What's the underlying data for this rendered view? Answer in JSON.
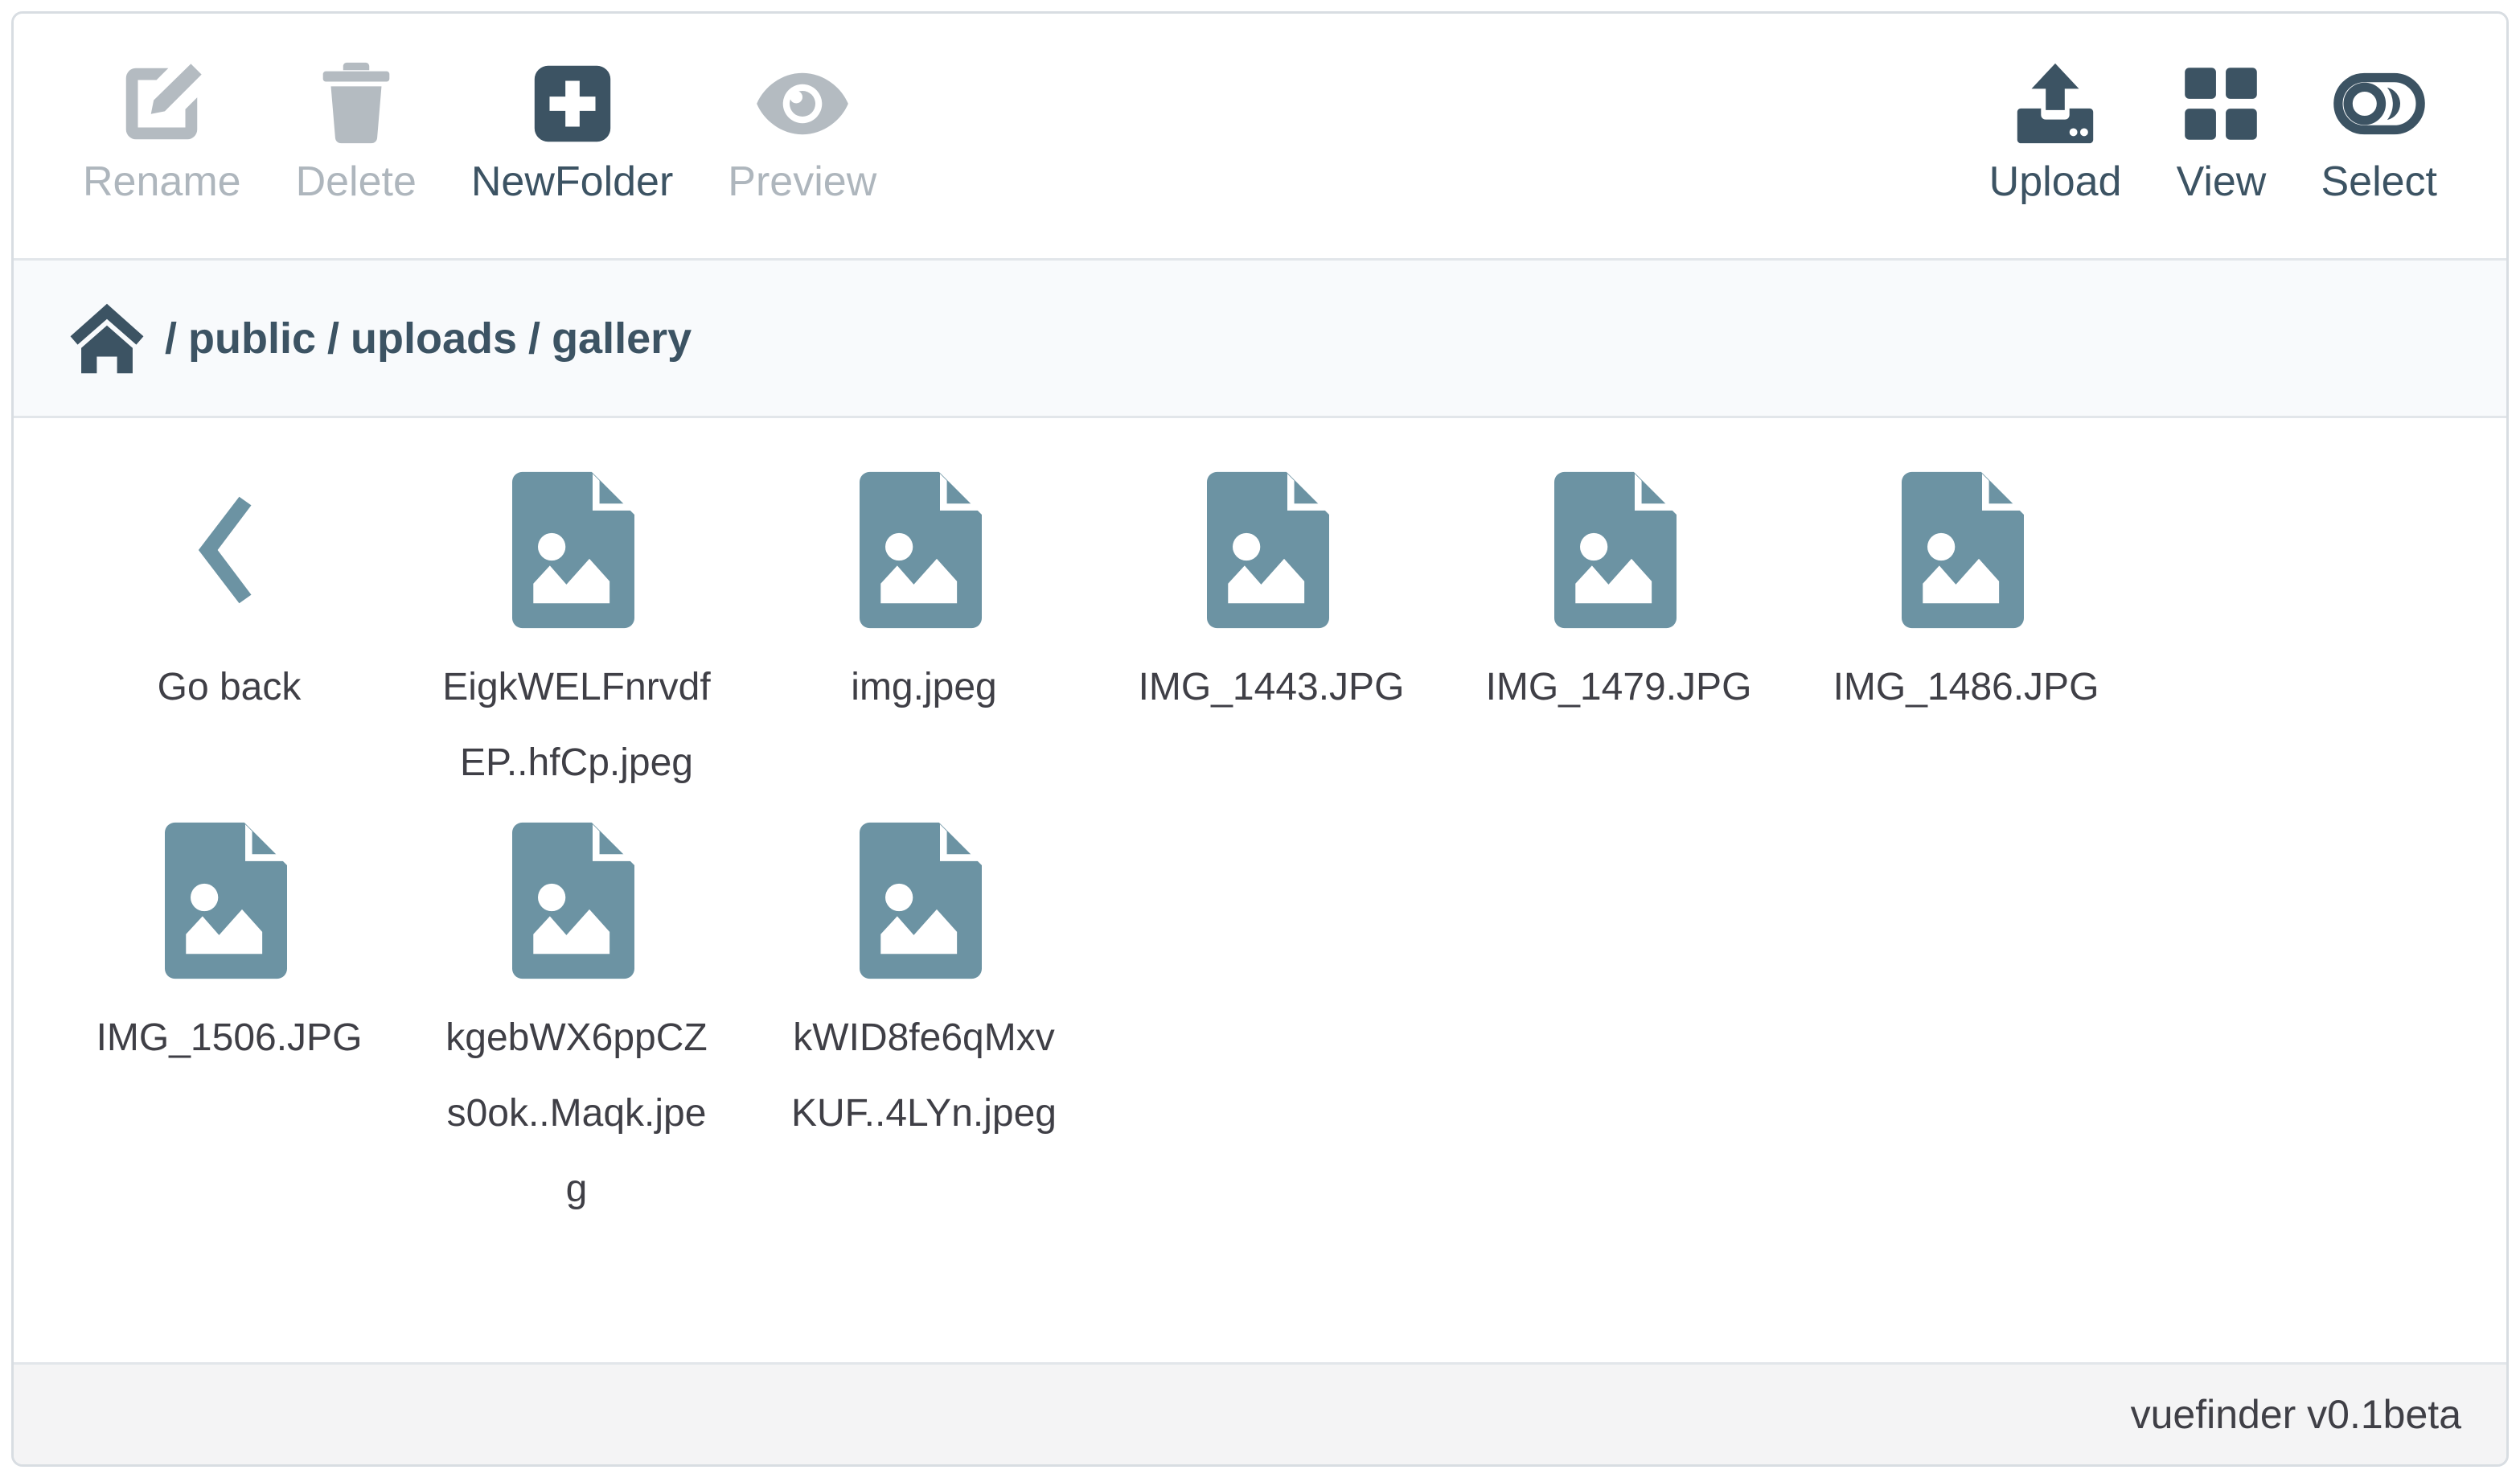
{
  "toolbar": {
    "left_buttons": [
      {
        "label": "Rename",
        "icon": "rename-icon",
        "disabled": true
      },
      {
        "label": "Delete",
        "icon": "trash-icon",
        "disabled": true
      },
      {
        "label": "NewFolder",
        "icon": "plus-square-icon",
        "disabled": false
      },
      {
        "label": "Preview",
        "icon": "eye-icon",
        "disabled": true
      }
    ],
    "right_buttons": [
      {
        "label": "Upload",
        "icon": "upload-icon",
        "disabled": false
      },
      {
        "label": "View",
        "icon": "grid-icon",
        "disabled": false
      },
      {
        "label": "Select",
        "icon": "toggle-on-icon",
        "disabled": false
      }
    ]
  },
  "breadcrumb": {
    "home_icon": "home-icon",
    "separator": "/",
    "segments": [
      "public",
      "uploads",
      "gallery"
    ]
  },
  "files": {
    "go_back": {
      "label": "Go back",
      "icon": "chevron-left-icon"
    },
    "items": [
      {
        "name": "EigkWELFnrvdfEP..hfCp.jpeg",
        "icon": "image-file-icon"
      },
      {
        "name": "img.jpeg",
        "icon": "image-file-icon"
      },
      {
        "name": "IMG_1443.JPG",
        "icon": "image-file-icon"
      },
      {
        "name": "IMG_1479.JPG",
        "icon": "image-file-icon"
      },
      {
        "name": "IMG_1486.JPG",
        "icon": "image-file-icon"
      },
      {
        "name": "IMG_1506.JPG",
        "icon": "image-file-icon"
      },
      {
        "name": "kgebWX6ppCZs0ok..Maqk.jpeg",
        "icon": "image-file-icon"
      },
      {
        "name": "kWID8fe6qMxvKUF..4LYn.jpeg",
        "icon": "image-file-icon"
      }
    ]
  },
  "footer": {
    "version_text": "vuefinder v0.1beta"
  },
  "colors": {
    "accent_dark": "#3c5363",
    "disabled_grey": "#b4bbc1",
    "file_icon_blue": "#6c93a3",
    "panel_border": "#d8dde2",
    "breadcrumb_bg": "#f8fafc",
    "footer_bg": "#f4f4f5",
    "text": "#3f3f46"
  }
}
